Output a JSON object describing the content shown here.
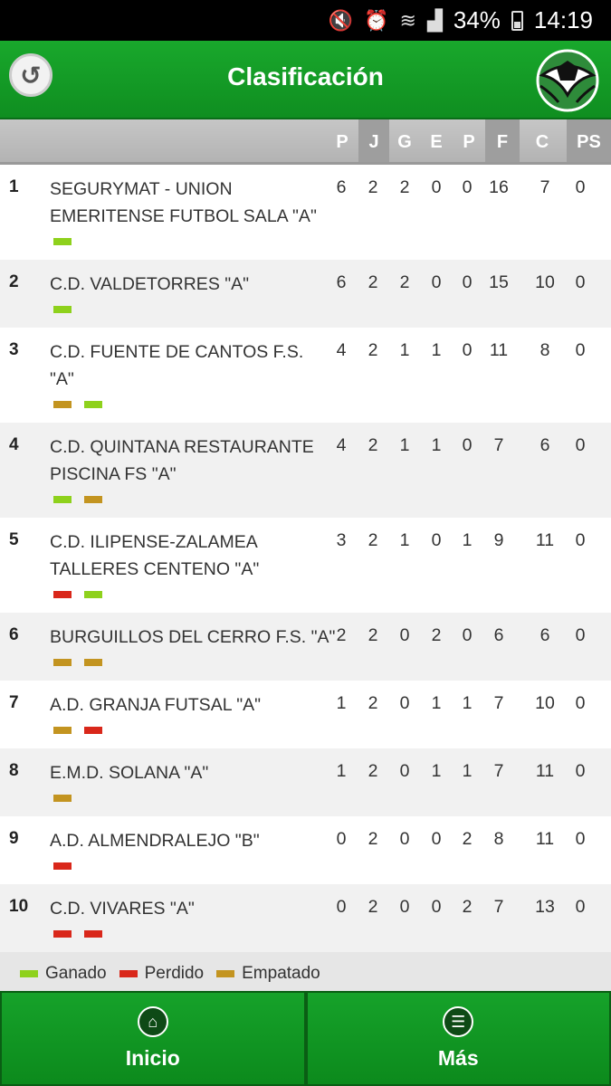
{
  "status_bar": {
    "battery": "34%",
    "time": "14:19"
  },
  "app_bar": {
    "title": "Clasificación"
  },
  "columns": [
    "P",
    "J",
    "G",
    "E",
    "P",
    "F",
    "C",
    "PS"
  ],
  "colors": {
    "won": "#8ed11c",
    "lost": "#d9271a",
    "drawn": "#c39420",
    "accent": "#14a127"
  },
  "rows": [
    {
      "rank": "1",
      "team": [
        "SEGURYMAT - UNION",
        "EMERITENSE FUTBOL SALA \"A\""
      ],
      "stats": [
        "6",
        "2",
        "2",
        "0",
        "0",
        "16",
        "7",
        "0"
      ],
      "form": [
        "won"
      ]
    },
    {
      "rank": "2",
      "team": [
        "C.D. VALDETORRES \"A\""
      ],
      "stats": [
        "6",
        "2",
        "2",
        "0",
        "0",
        "15",
        "10",
        "0"
      ],
      "form": [
        "won"
      ]
    },
    {
      "rank": "3",
      "team": [
        "C.D. FUENTE DE CANTOS F.S.",
        "\"A\""
      ],
      "stats": [
        "4",
        "2",
        "1",
        "1",
        "0",
        "11",
        "8",
        "0"
      ],
      "form": [
        "drawn",
        "won"
      ]
    },
    {
      "rank": "4",
      "team": [
        "C.D. QUINTANA RESTAURANTE",
        "PISCINA FS \"A\""
      ],
      "stats": [
        "4",
        "2",
        "1",
        "1",
        "0",
        "7",
        "6",
        "0"
      ],
      "form": [
        "won",
        "drawn"
      ]
    },
    {
      "rank": "5",
      "team": [
        "C.D. ILIPENSE-ZALAMEA",
        "TALLERES CENTENO \"A\""
      ],
      "stats": [
        "3",
        "2",
        "1",
        "0",
        "1",
        "9",
        "11",
        "0"
      ],
      "form": [
        "lost",
        "won"
      ]
    },
    {
      "rank": "6",
      "team": [
        "BURGUILLOS DEL CERRO F.S. \"A\""
      ],
      "stats": [
        "2",
        "2",
        "0",
        "2",
        "0",
        "6",
        "6",
        "0"
      ],
      "form": [
        "drawn",
        "drawn"
      ]
    },
    {
      "rank": "7",
      "team": [
        "A.D. GRANJA FUTSAL \"A\""
      ],
      "stats": [
        "1",
        "2",
        "0",
        "1",
        "1",
        "7",
        "10",
        "0"
      ],
      "form": [
        "drawn",
        "lost"
      ]
    },
    {
      "rank": "8",
      "team": [
        "E.M.D. SOLANA \"A\""
      ],
      "stats": [
        "1",
        "2",
        "0",
        "1",
        "1",
        "7",
        "11",
        "0"
      ],
      "form": [
        "drawn"
      ]
    },
    {
      "rank": "9",
      "team": [
        "A.D. ALMENDRALEJO \"B\""
      ],
      "stats": [
        "0",
        "2",
        "0",
        "0",
        "2",
        "8",
        "11",
        "0"
      ],
      "form": [
        "lost"
      ]
    },
    {
      "rank": "10",
      "team": [
        "C.D. VIVARES \"A\""
      ],
      "stats": [
        "0",
        "2",
        "0",
        "0",
        "2",
        "7",
        "13",
        "0"
      ],
      "form": [
        "lost",
        "lost"
      ]
    }
  ],
  "legend": {
    "won": "Ganado",
    "lost": "Perdido",
    "drawn": "Empatado"
  },
  "bottom_nav": {
    "home_label": "Inicio",
    "more_label": "Más"
  }
}
